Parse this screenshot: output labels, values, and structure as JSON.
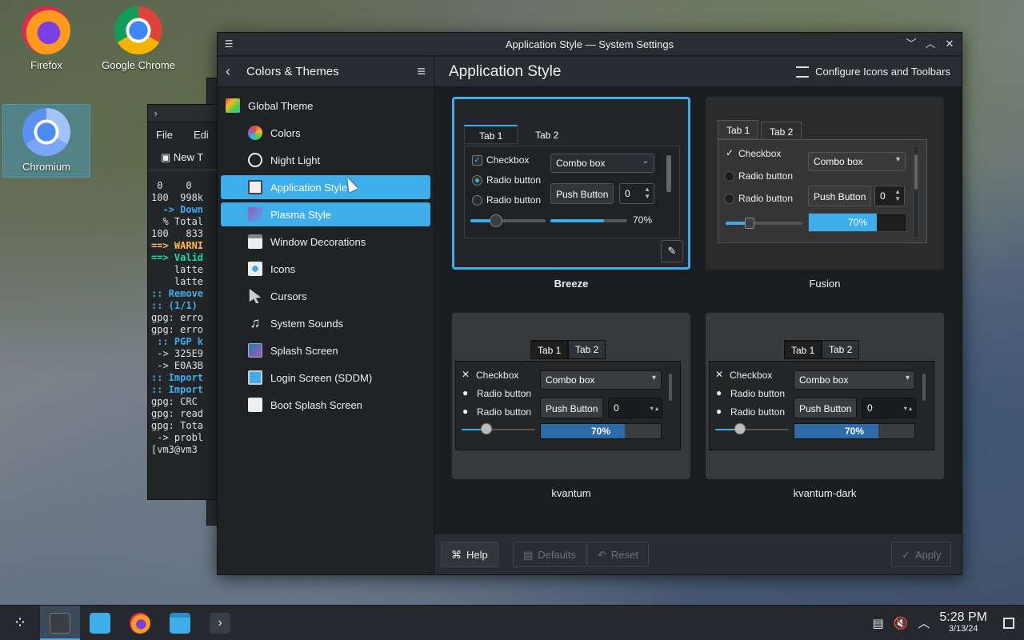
{
  "desktop": {
    "icons": [
      {
        "label": "Firefox"
      },
      {
        "label": "Google Chrome"
      },
      {
        "label": "Chromium"
      }
    ]
  },
  "terminal": {
    "menu": [
      "File",
      "Edi"
    ],
    "tab": "New T",
    "lines": [
      " 0    0",
      "100  998k",
      "  -> Down",
      "  % Total",
      "",
      "100   833",
      "==> WARNI",
      "==> Valid",
      "    latte",
      "    latte",
      ":: Remove",
      ":: (1/1)",
      "gpg: erro",
      "gpg: erro",
      "",
      " :: PGP k",
      " -> 325E9",
      " -> E0A3B",
      ":: Import",
      ":: Import",
      "gpg: CRC",
      "gpg: read",
      "gpg: Tota",
      " -> probl",
      "[vm3@vm3"
    ]
  },
  "window": {
    "title": "Application Style — System Settings",
    "controls": {
      "minimize": "﹀",
      "maximize": "︿",
      "close": "✕"
    }
  },
  "sidebar": {
    "breadcrumb": "Colors & Themes",
    "items": [
      {
        "label": "Global Theme"
      },
      {
        "label": "Colors"
      },
      {
        "label": "Night Light"
      },
      {
        "label": "Application Style"
      },
      {
        "label": "Plasma Style"
      },
      {
        "label": "Window Decorations"
      },
      {
        "label": "Icons"
      },
      {
        "label": "Cursors"
      },
      {
        "label": "System Sounds"
      },
      {
        "label": "Splash Screen"
      },
      {
        "label": "Login Screen (SDDM)"
      },
      {
        "label": "Boot Splash Screen"
      }
    ]
  },
  "main": {
    "title": "Application Style",
    "configure_label": "Configure Icons and Toolbars"
  },
  "styles": [
    {
      "name": "Breeze",
      "selected": true
    },
    {
      "name": "Fusion",
      "selected": false
    },
    {
      "name": "kvantum",
      "selected": false
    },
    {
      "name": "kvantum-dark",
      "selected": false
    }
  ],
  "preview": {
    "tab1": "Tab 1",
    "tab2": "Tab 2",
    "checkbox": "Checkbox",
    "radio": "Radio button",
    "combo": "Combo box",
    "push": "Push Button",
    "spin": "0",
    "progress": "70%",
    "progress_value": 0.7
  },
  "footer": {
    "help": "Help",
    "defaults": "Defaults",
    "reset": "Reset",
    "apply": "Apply"
  },
  "taskbar": {
    "time": "5:28 PM",
    "date": "3/13/24"
  },
  "colors": {
    "accent": "#3daee9",
    "window_bg": "#202326",
    "header_bg": "#292c30"
  }
}
